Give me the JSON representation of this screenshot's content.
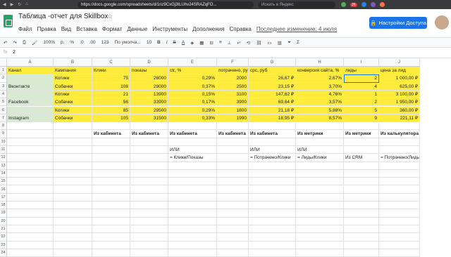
{
  "browser": {
    "url": "https://docs.google.com/spreadsheets/d/1nz9CxGj3tLUhv24SRAZqFO...",
    "search_placeholder": "Искать в Яндекс",
    "badge": "26"
  },
  "doc": {
    "title": "Таблица -отчет для Skillbox",
    "star": "☆",
    "access_button": "Настройки Доступа",
    "menu": [
      "Файл",
      "Правка",
      "Вид",
      "Вставка",
      "Формат",
      "Данные",
      "Инструменты",
      "Дополнения",
      "Справка"
    ],
    "last_edit": "Последнее изменение: 4 июля"
  },
  "toolbar": {
    "zoom": "100%",
    "currency": "р.",
    "percent": "%",
    "dec0": ".0",
    "dec00": ".00",
    "format": "123",
    "font": "По умолча...",
    "size": "10",
    "bold": "B",
    "italic": "I",
    "strike": "S",
    "color": "A"
  },
  "formula_bar": {
    "fx": "fx",
    "value": "2"
  },
  "columns": [
    "A",
    "B",
    "C",
    "D",
    "E",
    "F",
    "G",
    "H",
    "I",
    "J"
  ],
  "row_numbers": [
    "1",
    "2",
    "3",
    "4",
    "5",
    "6",
    "7",
    "8",
    "9",
    "10",
    "11",
    "12",
    "13",
    "14",
    "15",
    "16",
    "17",
    "18",
    "19",
    "20",
    "21",
    "22",
    "23",
    "24"
  ],
  "table": {
    "headers": [
      "Канал",
      "Кампания",
      "Клики",
      "показы",
      "ctr, %",
      "потрачено, руб",
      "cpc, руб",
      "конверсия сайта, %",
      "лиды",
      "цена за лид"
    ],
    "rows": [
      [
        "",
        "Котики",
        "75",
        "26000",
        "0,29%",
        "2000",
        "26,67 ₽",
        "2,67%",
        "2",
        "1 000,00 ₽"
      ],
      [
        "Вконтакте",
        "Собачки",
        "108",
        "29000",
        "0,37%",
        "2500",
        "23,15 ₽",
        "3,70%",
        "4",
        "625,00 ₽"
      ],
      [
        "",
        "Котики",
        "21",
        "13900",
        "0,15%",
        "3100",
        "147,62 ₽",
        "4,76%",
        "1",
        "3 100,00 ₽"
      ],
      [
        "Facebook",
        "Собачки",
        "56",
        "33900",
        "0,17%",
        "3900",
        "69,64 ₽",
        "3,57%",
        "2",
        "1 950,00 ₽"
      ],
      [
        "",
        "Котики",
        "85",
        "29500",
        "0,29%",
        "1800",
        "21,18 ₽",
        "5,88%",
        "5",
        "360,00 ₽"
      ],
      [
        "Instagram",
        "Собачки",
        "105",
        "31500",
        "0,33%",
        "1990",
        "18,95 ₽",
        "8,57%",
        "9",
        "221,11 ₽"
      ]
    ],
    "notes_row1": [
      "Из кабинета",
      "Из кабинета",
      "Из кабинета",
      "Из кабинета",
      "Из кабинета",
      "Из метрики",
      "Из метрики",
      "Из калькулятора"
    ],
    "notes_or": "ИЛИ",
    "notes_row3": [
      "= Клики/Показы",
      "= Потрачено/Клики",
      "= Лиды/Клики",
      "Из CRM",
      "= Потрачено/Лиды"
    ]
  }
}
